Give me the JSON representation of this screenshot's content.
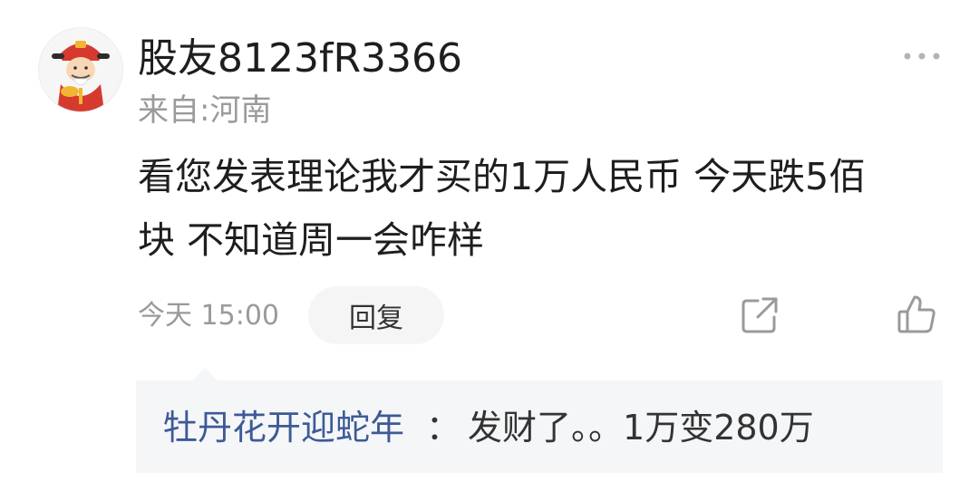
{
  "comment": {
    "username": "股友8123fR3366",
    "location": "来自:河南",
    "text_line1": "看您发表理论我才买的1万人民币 今天跌5佰",
    "text_line2": "块 不知道周一会咋样",
    "timestamp": "今天 15:00",
    "reply_button_label": "回复",
    "icons": {
      "avatar": "fortune-god-avatar",
      "more": "more-dots-icon",
      "share": "share-icon",
      "like": "thumbs-up-icon"
    }
  },
  "reply_preview": {
    "author": "牡丹花开迎蛇年",
    "separator": "：",
    "content": "发财了。。1万变280万"
  },
  "colors": {
    "reply_author": "#3d5a96",
    "reply_box_bg": "#f5f6f8",
    "secondary_text": "#9a9a9a",
    "reply_button_bg": "#f5f5f5"
  }
}
